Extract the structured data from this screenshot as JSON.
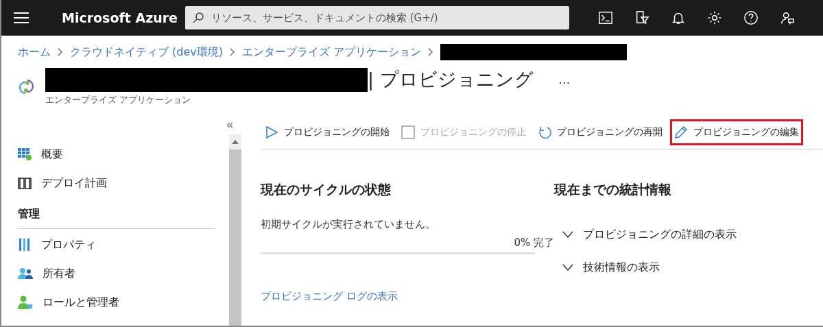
{
  "top_bar": {
    "brand": "Microsoft Azure",
    "search": {
      "placeholder": "リソース、サービス、ドキュメントの検索 (G+/)"
    },
    "icons": [
      {
        "kind": "terminal"
      },
      {
        "kind": "filter"
      },
      {
        "kind": "bell"
      },
      {
        "kind": "settings"
      },
      {
        "kind": "help"
      },
      {
        "kind": "feedback"
      }
    ]
  },
  "breadcrumb": {
    "items": [
      "ホーム",
      "クラウドネイティブ (dev環境)",
      "エンタープライズ アプリケーション"
    ],
    "redacted_tail": true
  },
  "header": {
    "title_redacted": true,
    "title": "| プロビジョニング",
    "subtitle": "エンタープライズ アプリケーション",
    "more": "…"
  },
  "sidebar": {
    "collapse": "«",
    "sections": [
      {
        "items": [
          {
            "label": "概要",
            "kind": "grid"
          },
          {
            "label": "デプロイ計画",
            "kind": "book"
          }
        ]
      },
      {
        "heading": "管理",
        "items": [
          {
            "label": "プロパティ",
            "kind": "bars"
          },
          {
            "label": "所有者",
            "kind": "people"
          },
          {
            "label": "ロールと管理者",
            "kind": "admin"
          }
        ]
      }
    ]
  },
  "toolbar": [
    {
      "label": "プロビジョニングの開始",
      "kind": "play",
      "disabled": false,
      "highlighted": false
    },
    {
      "label": "プロビジョニングの停止",
      "kind": "stop",
      "disabled": true,
      "highlighted": false
    },
    {
      "label": "プロビジョニングの再開",
      "kind": "restart",
      "disabled": false,
      "highlighted": false
    },
    {
      "label": "プロビジョニングの編集",
      "kind": "edit",
      "disabled": false,
      "highlighted": true
    }
  ],
  "cycle": {
    "heading": "現在のサイクルの状態",
    "status": "初期サイクルが実行されていません。",
    "level": 0,
    "reading": "0% 完了",
    "link": "プロビジョニング ログの表示"
  },
  "stats": {
    "heading": "現在までの統計情報",
    "items": [
      {
        "label": "プロビジョニングの詳細の表示",
        "expanded": false
      },
      {
        "label": "技術情報の表示",
        "expanded": false
      }
    ]
  }
}
